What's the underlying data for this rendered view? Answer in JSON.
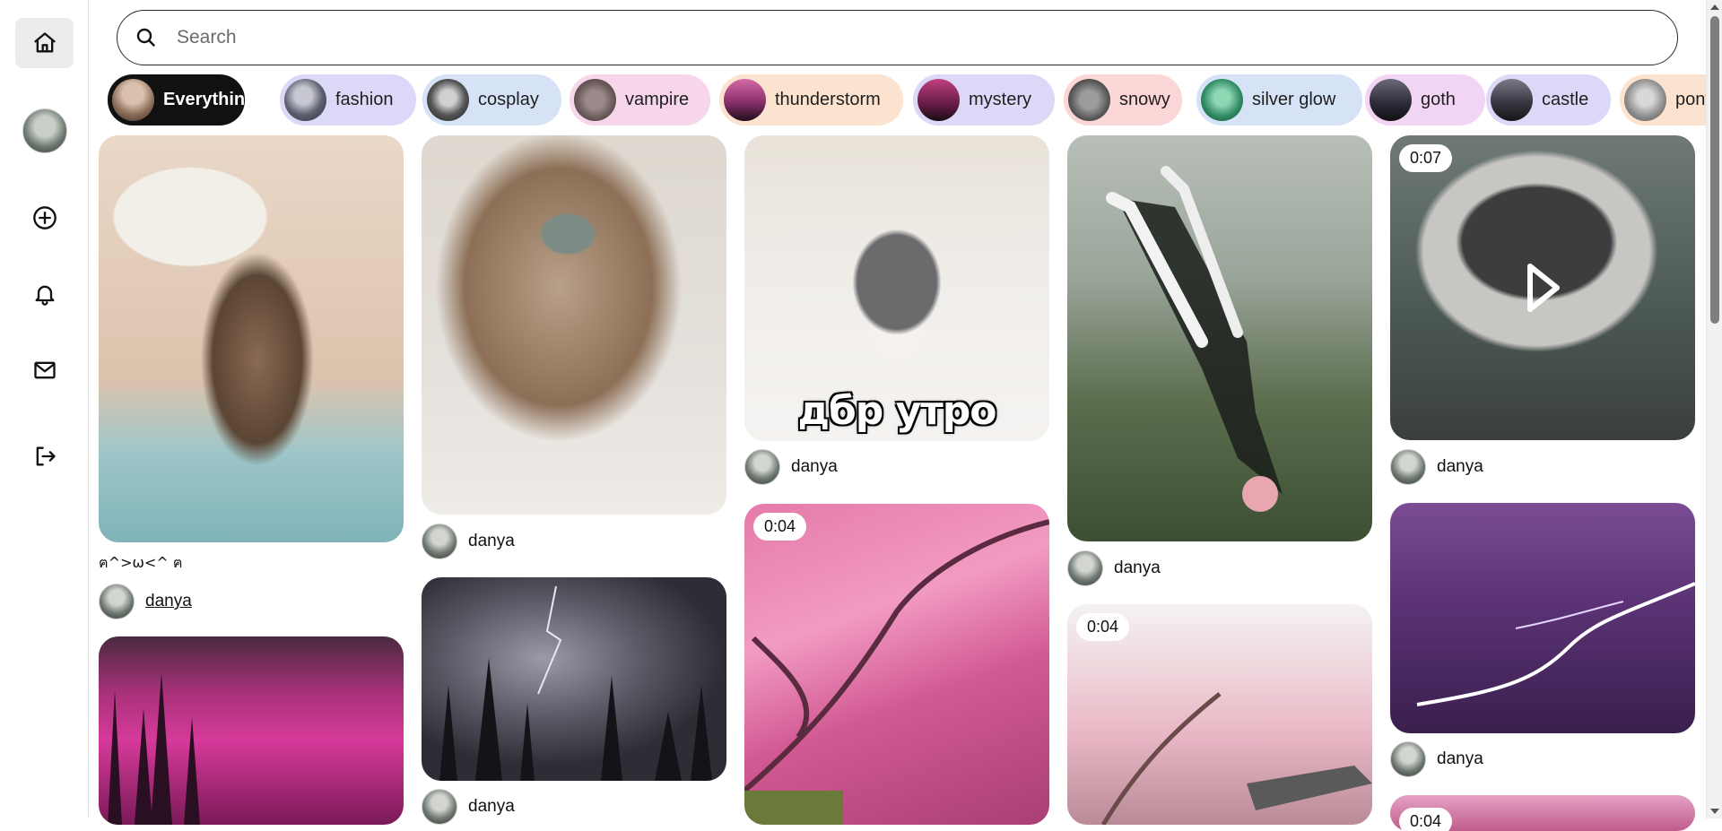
{
  "sidebar": {
    "items": [
      {
        "name": "home-icon",
        "active": true
      },
      {
        "name": "profile-avatar"
      },
      {
        "name": "create-icon"
      },
      {
        "name": "notifications-icon"
      },
      {
        "name": "messages-icon"
      },
      {
        "name": "logout-icon"
      }
    ]
  },
  "search": {
    "placeholder": "Search",
    "value": ""
  },
  "chips": [
    {
      "label": "Everything",
      "active": true
    },
    {
      "label": "fashion"
    },
    {
      "label": "cosplay"
    },
    {
      "label": "vampire"
    },
    {
      "label": "thunderstorm"
    },
    {
      "label": "mystery"
    },
    {
      "label": "snowy"
    },
    {
      "label": "silver glow"
    },
    {
      "label": "goth"
    },
    {
      "label": "castle"
    },
    {
      "label": "pony"
    }
  ],
  "pins": [
    {
      "caption": "ฅ^>ω<^ ฅ",
      "author": "danya"
    },
    {
      "author": "danya"
    },
    {
      "author": "danya"
    },
    {
      "overlay_text": "дбр утро",
      "author": "danya"
    },
    {
      "duration": "0:04"
    },
    {
      "author": "danya"
    },
    {
      "duration": "0:04"
    },
    {
      "duration": "0:07",
      "author": "danya"
    },
    {
      "author": "danya"
    },
    {
      "duration": "0:04"
    }
  ]
}
